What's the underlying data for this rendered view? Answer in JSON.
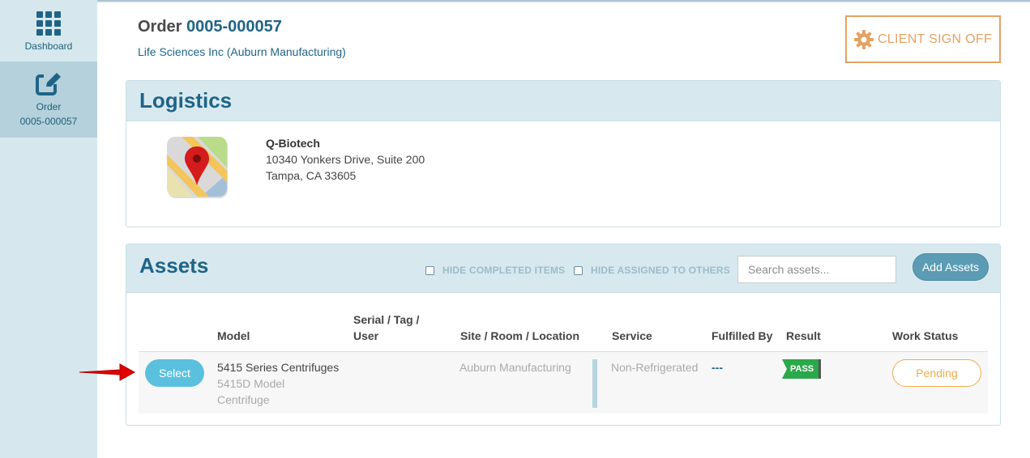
{
  "sidebar": {
    "items": [
      {
        "label": "Dashboard"
      },
      {
        "label_line1": "Order",
        "label_line2": "0005-000057"
      }
    ]
  },
  "header": {
    "order_prefix": "Order",
    "order_number": "0005-000057",
    "client": "Life Sciences Inc (Auburn Manufacturing)",
    "signoff_label": "CLIENT SIGN OFF"
  },
  "logistics": {
    "title": "Logistics",
    "site_name": "Q-Biotech",
    "address_line1": "10340 Yonkers Drive, Suite 200",
    "address_line2": "Tampa, CA 33605"
  },
  "assets": {
    "title": "Assets",
    "filter_completed": "HIDE COMPLETED ITEMS",
    "filter_assigned": "HIDE ASSIGNED TO OTHERS",
    "search_placeholder": "Search assets...",
    "add_label": "Add Assets",
    "columns": {
      "model": "Model",
      "serial_line1": "Serial / Tag /",
      "serial_line2": "User",
      "site": "Site / Room / Location",
      "service": "Service",
      "fulfilled": "Fulfilled By",
      "result": "Result",
      "status": "Work Status"
    },
    "rows": [
      {
        "select_label": "Select",
        "model": "5415 Series Centrifuges",
        "model_sub1": "5415D Model",
        "model_sub2": "Centrifuge",
        "site": "Auburn Manufacturing",
        "service": "Non-Refrigerated",
        "fulfilled_by": "---",
        "result": "PASS",
        "work_status": "Pending"
      }
    ]
  },
  "colors": {
    "primary": "#1f6487",
    "accent_orange": "#e4a263",
    "pass_green": "#2aa84a",
    "select_blue": "#5bc0de",
    "arrow_red": "#e00000"
  }
}
